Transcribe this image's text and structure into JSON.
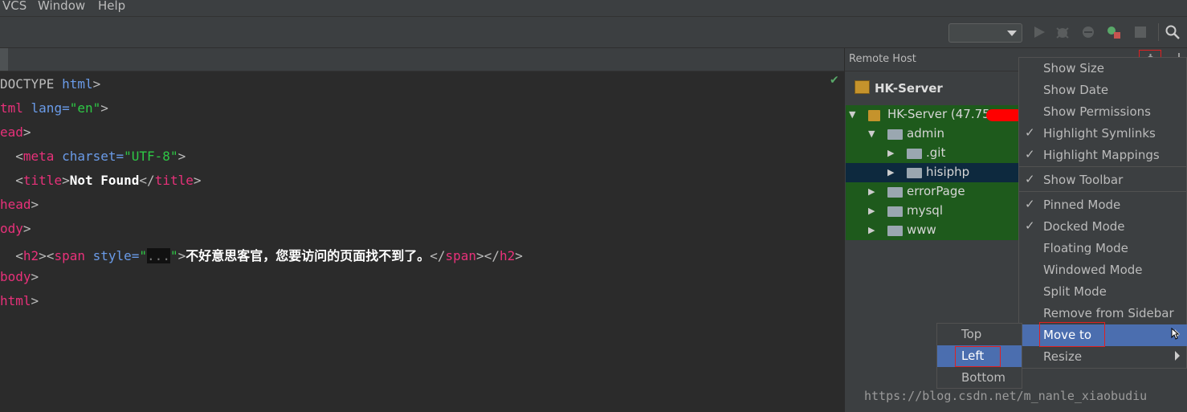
{
  "menubar": {
    "items": [
      "VCS",
      "Window",
      "Help"
    ]
  },
  "editor": {
    "lines": [
      {
        "parts": [
          {
            "t": "DOCTYPE ",
            "c": "br"
          },
          {
            "t": "html",
            "c": "attr"
          },
          {
            "t": ">",
            "c": "br"
          }
        ]
      },
      {
        "parts": [
          {
            "t": "tml",
            "c": "tag"
          },
          {
            "t": " lang=",
            "c": "attr"
          },
          {
            "t": "\"en\"",
            "c": "str"
          },
          {
            "t": ">",
            "c": "br"
          }
        ]
      },
      {
        "parts": [
          {
            "t": "ead",
            "c": "tag"
          },
          {
            "t": ">",
            "c": "br"
          }
        ]
      },
      {
        "parts": [
          {
            "t": "  <",
            "c": "br"
          },
          {
            "t": "meta",
            "c": "tag"
          },
          {
            "t": " charset=",
            "c": "attr"
          },
          {
            "t": "\"UTF-8\"",
            "c": "str"
          },
          {
            "t": ">",
            "c": "br"
          }
        ]
      },
      {
        "parts": [
          {
            "t": "  <",
            "c": "br"
          },
          {
            "t": "title",
            "c": "tag"
          },
          {
            "t": ">",
            "c": "br"
          },
          {
            "t": "Not Found",
            "c": "bold"
          },
          {
            "t": "</",
            "c": "br"
          },
          {
            "t": "title",
            "c": "tag"
          },
          {
            "t": ">",
            "c": "br"
          }
        ]
      },
      {
        "parts": [
          {
            "t": "head",
            "c": "tag"
          },
          {
            "t": ">",
            "c": "br"
          }
        ]
      },
      {
        "parts": [
          {
            "t": "ody",
            "c": "tag"
          },
          {
            "t": ">",
            "c": "br"
          }
        ]
      },
      {
        "parts": [
          {
            "t": "  <",
            "c": "br"
          },
          {
            "t": "h2",
            "c": "tag"
          },
          {
            "t": "><",
            "c": "br"
          },
          {
            "t": "span",
            "c": "tag"
          },
          {
            "t": " style=",
            "c": "attr"
          },
          {
            "t": "\"",
            "c": "str"
          },
          {
            "t": "...",
            "c": "hidden-val"
          },
          {
            "t": "\"",
            "c": "str"
          },
          {
            "t": ">",
            "c": "br"
          },
          {
            "t": "不好意思客官，您要访问的页面找不到了。",
            "c": "bold"
          },
          {
            "t": "</",
            "c": "br"
          },
          {
            "t": "span",
            "c": "tag"
          },
          {
            "t": "></",
            "c": "br"
          },
          {
            "t": "h2",
            "c": "tag"
          },
          {
            "t": ">",
            "c": "br"
          }
        ]
      },
      {
        "parts": [
          {
            "t": "body",
            "c": "tag"
          },
          {
            "t": ">",
            "c": "br"
          }
        ]
      },
      {
        "parts": [
          {
            "t": "html",
            "c": "tag"
          },
          {
            "t": ">",
            "c": "br"
          }
        ]
      }
    ]
  },
  "remote_host": {
    "title": "Remote Host",
    "server_name": "HK-Server",
    "tree": [
      {
        "label": "HK-Server (47.75.",
        "depth": 0,
        "expanded": true,
        "icon": "server-icon"
      },
      {
        "label": "admin",
        "depth": 1,
        "expanded": true,
        "icon": "folder-icon"
      },
      {
        "label": ".git",
        "depth": 2,
        "expanded": false,
        "icon": "folder-icon"
      },
      {
        "label": "hisiphp",
        "depth": 2,
        "expanded": false,
        "icon": "folder-icon",
        "selected": true
      },
      {
        "label": "errorPage",
        "depth": 1,
        "expanded": false,
        "icon": "folder-icon"
      },
      {
        "label": "mysql",
        "depth": 1,
        "expanded": false,
        "icon": "folder-icon"
      },
      {
        "label": "www",
        "depth": 1,
        "expanded": false,
        "icon": "folder-icon"
      }
    ]
  },
  "context_menu": {
    "items": [
      {
        "label": "Show Size",
        "checked": false
      },
      {
        "label": "Show Date",
        "checked": false
      },
      {
        "label": "Show Permissions",
        "checked": false
      },
      {
        "label": "Highlight Symlinks",
        "checked": true
      },
      {
        "label": "Highlight Mappings",
        "checked": true
      },
      {
        "label": "Show Toolbar",
        "checked": true
      },
      {
        "label": "Pinned Mode",
        "checked": true
      },
      {
        "label": "Docked Mode",
        "checked": true
      },
      {
        "label": "Floating Mode",
        "checked": false
      },
      {
        "label": "Windowed Mode",
        "checked": false
      },
      {
        "label": "Split Mode",
        "checked": false
      },
      {
        "label": "Remove from Sidebar",
        "checked": false
      },
      {
        "label": "Move to",
        "checked": false,
        "submenu": true,
        "highlighted": true
      },
      {
        "label": "Resize",
        "checked": false,
        "submenu": true
      }
    ]
  },
  "move_to_submenu": {
    "items": [
      {
        "label": "Top"
      },
      {
        "label": "Left",
        "highlighted": true
      },
      {
        "label": "Bottom"
      }
    ]
  },
  "watermark": "https://blog.csdn.net/m_nanle_xiaobudiu",
  "colors": {
    "accent": "#4b6eaf",
    "tree_bg": "#1e5a1c",
    "highlight_box": "#e02020"
  }
}
